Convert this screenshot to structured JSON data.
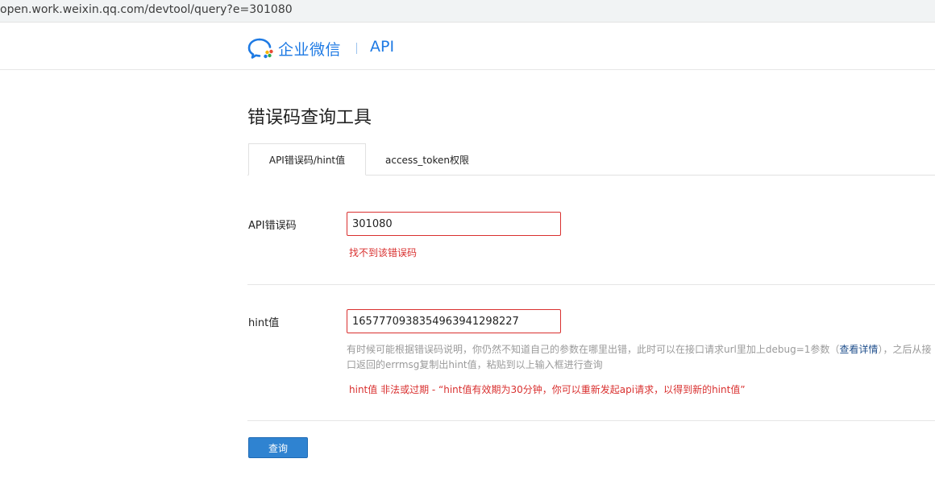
{
  "browser": {
    "url": "open.work.weixin.qq.com/devtool/query?e=301080"
  },
  "header": {
    "brand_name": "企业微信",
    "brand_suffix": "API"
  },
  "page": {
    "title": "错误码查询工具"
  },
  "tabs": [
    {
      "label": "API错误码/hint值",
      "active": true
    },
    {
      "label": "access_token权限",
      "active": false
    }
  ],
  "form": {
    "errcode": {
      "label": "API错误码",
      "value": "301080",
      "error": "找不到该错误码"
    },
    "hint": {
      "label": "hint值",
      "value": "16577709383549639412​98227",
      "help_before": "有时候可能根据错误码说明，你仍然不知道自己的参数在哪里出错，此时可以在接口请求url里加上debug=1参数（",
      "help_link": "查看详情",
      "help_after": "），之后从接口返回的errmsg复制出hint值，粘贴到以上输入框进行查询",
      "error": "hint值 非法或过期 - “hint值有效期为30分钟，你可以重新发起api请求，以得到新的hint值”"
    },
    "submit_label": "查询"
  },
  "colors": {
    "brand_blue": "#1e7ae4",
    "error_red": "#d9302f",
    "button_blue": "#2f83d1"
  }
}
